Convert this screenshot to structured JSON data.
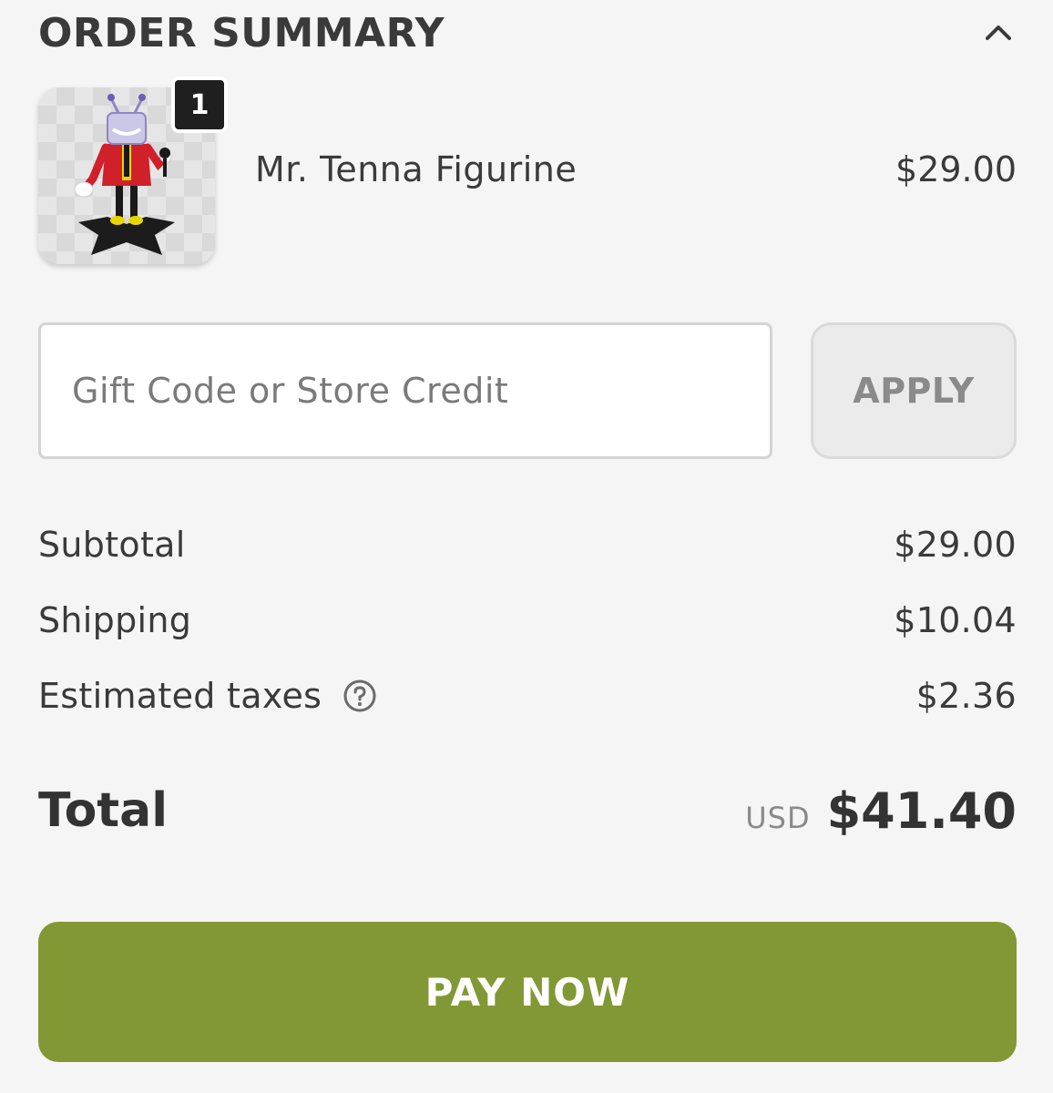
{
  "summary": {
    "title": "ORDER SUMMARY",
    "toggle_icon": "chevron-up-icon"
  },
  "items": [
    {
      "name": "Mr. Tenna Figurine",
      "price": "$29.00",
      "quantity": "1"
    }
  ],
  "gift": {
    "placeholder": "Gift Code or Store Credit",
    "value": "",
    "apply_label": "APPLY"
  },
  "costs": {
    "subtotal_label": "Subtotal",
    "subtotal_value": "$29.00",
    "shipping_label": "Shipping",
    "shipping_value": "$10.04",
    "taxes_label": "Estimated taxes",
    "taxes_value": "$2.36",
    "taxes_icon": "help-icon"
  },
  "total": {
    "label": "Total",
    "currency": "USD",
    "amount": "$41.40"
  },
  "pay": {
    "label": "PAY NOW",
    "color": "#829834"
  }
}
